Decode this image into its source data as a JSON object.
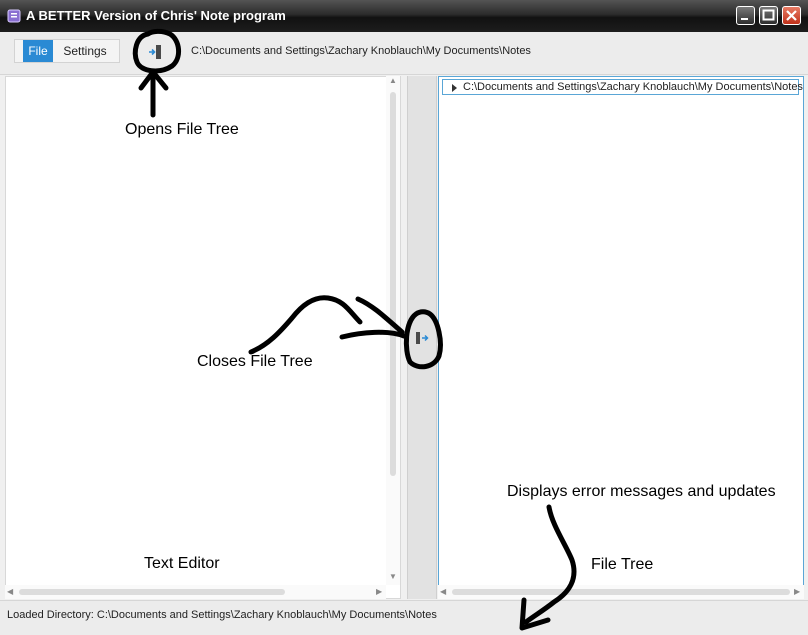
{
  "window": {
    "title": "A BETTER Version of Chris' Note program"
  },
  "toolbar": {
    "tabs": [
      {
        "label": "File",
        "active": true
      },
      {
        "label": "Settings",
        "active": false
      }
    ],
    "path": "C:\\Documents and Settings\\Zachary Knoblauch\\My Documents\\Notes"
  },
  "file_tree": {
    "root_label": "C:\\Documents and Settings\\Zachary Knoblauch\\My Documents\\Notes"
  },
  "status": {
    "text": "Loaded Directory: C:\\Documents and Settings\\Zachary Knoblauch\\My Documents\\Notes"
  },
  "annotations": {
    "opens_tree": "Opens File Tree",
    "closes_tree": "Closes File Tree",
    "text_editor": "Text Editor",
    "error_messages": "Displays error messages and updates",
    "file_tree": "File Tree"
  },
  "colors": {
    "accent": "#2a8ad4",
    "tree_border": "#5aa6d6",
    "close_button": "#c0311a"
  }
}
